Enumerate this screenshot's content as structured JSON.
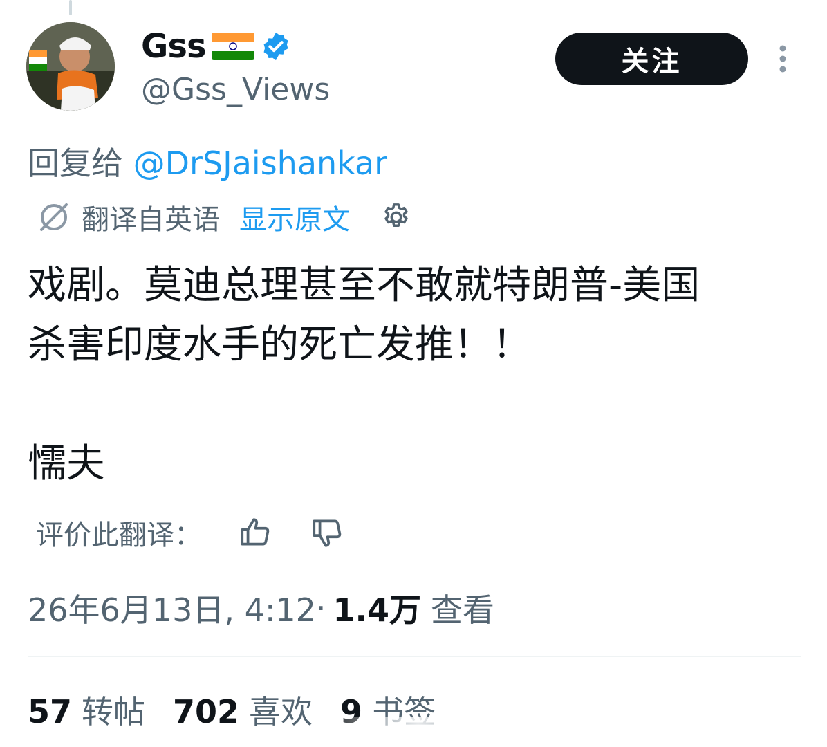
{
  "author": {
    "display_name": "Gss",
    "flag_icon": "india-flag-icon",
    "verified_icon": "verified-badge-icon",
    "handle": "@Gss_Views"
  },
  "follow_button": {
    "label": "关注"
  },
  "more_icon": "more-vertical-icon",
  "reply_to": {
    "prefix": "回复给 ",
    "mention": "@DrSJaishankar"
  },
  "translation": {
    "icon": "translate-icon",
    "label": "翻译自英语",
    "show_original": "显示原文",
    "settings_icon": "gear-icon"
  },
  "tweet": {
    "line1": "戏剧。莫迪总理甚至不敢就特朗普-美国",
    "line2": "杀害印度水手的死亡发推！！",
    "line3": "懦夫"
  },
  "rate_translation": {
    "label": "评价此翻译：",
    "thumbs_up_icon": "thumbs-up-icon",
    "thumbs_down_icon": "thumbs-down-icon"
  },
  "meta": {
    "timestamp": "26年6月13日, 4:12",
    "separator": " · ",
    "views_count": "1.4万",
    "views_label": "查看"
  },
  "stats": [
    {
      "count": "57",
      "label": "转帖"
    },
    {
      "count": "702",
      "label": "喜欢"
    },
    {
      "count": "9",
      "label": "书签"
    }
  ],
  "colors": {
    "accent_blue": "#1d9bf0",
    "text_primary": "#0f1419",
    "text_secondary": "#536471",
    "button_bg": "#0f1419",
    "flag_saffron": "#ff9933",
    "flag_green": "#138808",
    "flag_chakra": "#000080"
  }
}
